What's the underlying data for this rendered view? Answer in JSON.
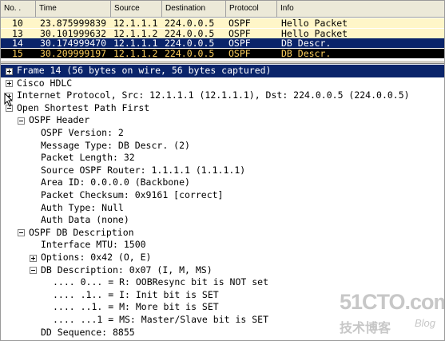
{
  "packet_list": {
    "columns": {
      "no": "No. .",
      "time": "Time",
      "source": "Source",
      "destination": "Destination",
      "protocol": "Protocol",
      "info": "Info"
    },
    "rows": [
      {
        "no": "10",
        "time": "23.875999839",
        "source": "12.1.1.1",
        "destination": "224.0.0.5",
        "protocol": "OSPF",
        "info": "Hello Packet",
        "state": "hello"
      },
      {
        "no": "13",
        "time": "30.101999632",
        "source": "12.1.1.2",
        "destination": "224.0.0.5",
        "protocol": "OSPF",
        "info": "Hello Packet",
        "state": "hello"
      },
      {
        "no": "14",
        "time": "30.174999470",
        "source": "12.1.1.1",
        "destination": "224.0.0.5",
        "protocol": "OSPF",
        "info": "DB Descr.",
        "state": "selected"
      },
      {
        "no": "15",
        "time": "30.209999197",
        "source": "12.1.1.2",
        "destination": "224.0.0.5",
        "protocol": "OSPF",
        "info": "DB Descr.",
        "state": "dark"
      }
    ]
  },
  "detail_tree": [
    {
      "text": "Frame 14 (56 bytes on wire, 56 bytes captured)",
      "toggle": "plus",
      "level": 0,
      "selected": true
    },
    {
      "text": "Cisco HDLC",
      "toggle": "plus",
      "level": 0
    },
    {
      "text": "Internet Protocol, Src: 12.1.1.1 (12.1.1.1), Dst: 224.0.0.5 (224.0.0.5)",
      "toggle": "plus",
      "level": 0
    },
    {
      "text": "Open Shortest Path First",
      "toggle": "minus",
      "level": 0
    },
    {
      "text": "OSPF Header",
      "toggle": "minus",
      "level": 1
    },
    {
      "text": "OSPF Version: 2",
      "toggle": "",
      "level": 2
    },
    {
      "text": "Message Type: DB Descr. (2)",
      "toggle": "",
      "level": 2
    },
    {
      "text": "Packet Length: 32",
      "toggle": "",
      "level": 2
    },
    {
      "text": "Source OSPF Router: 1.1.1.1 (1.1.1.1)",
      "toggle": "",
      "level": 2
    },
    {
      "text": "Area ID: 0.0.0.0 (Backbone)",
      "toggle": "",
      "level": 2
    },
    {
      "text": "Packet Checksum: 0x9161 [correct]",
      "toggle": "",
      "level": 2
    },
    {
      "text": "Auth Type: Null",
      "toggle": "",
      "level": 2
    },
    {
      "text": "Auth Data (none)",
      "toggle": "",
      "level": 2
    },
    {
      "text": "OSPF DB Description",
      "toggle": "minus",
      "level": 1
    },
    {
      "text": "Interface MTU: 1500",
      "toggle": "",
      "level": 2
    },
    {
      "text": "Options: 0x42 (O, E)",
      "toggle": "plus",
      "level": 2
    },
    {
      "text": "DB Description: 0x07 (I, M, MS)",
      "toggle": "minus",
      "level": 2
    },
    {
      "text": ".... 0... = R: OOBResync bit is NOT set",
      "toggle": "",
      "level": 3
    },
    {
      "text": ".... .1.. = I: Init bit is SET",
      "toggle": "",
      "level": 3
    },
    {
      "text": ".... ..1. = M: More bit is SET",
      "toggle": "",
      "level": 3
    },
    {
      "text": ".... ...1 = MS: Master/Slave bit is SET",
      "toggle": "",
      "level": 3
    },
    {
      "text": "DD Sequence: 8855",
      "toggle": "",
      "level": 2
    }
  ],
  "watermark": {
    "site": "51CTO.com",
    "tagline": "技术博客",
    "blog": "Blog"
  },
  "colors": {
    "hello_row_bg": "#fff6c8",
    "selected_bg": "#0a246a",
    "dark_row_bg": "#000000",
    "dark_row_fg": "#ffd15e",
    "header_bg": "#ece9d8"
  },
  "icons": {
    "expand": "plus-box-icon",
    "collapse": "minus-box-icon",
    "pointer": "mouse-cursor-icon"
  }
}
